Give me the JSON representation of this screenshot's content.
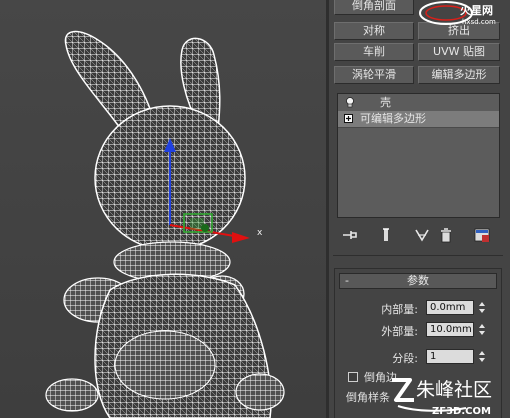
{
  "viewport": {
    "axis_label": "x"
  },
  "modifier_buttons": {
    "bevel_profile": "倒角剖面",
    "symmetry": "对称",
    "extrude": "挤出",
    "lathe": "车削",
    "uvw_map": "UVW 贴图",
    "turbosmooth": "涡轮平滑",
    "edit_poly": "编辑多边形"
  },
  "brand": {
    "logo_text": "火星网",
    "logo_sub": "hxsd.com"
  },
  "modifier_stack": {
    "items": [
      {
        "label": "壳",
        "icon": "lightbulb-icon"
      },
      {
        "label": "可编辑多边形",
        "icon": "expand-plus-icon"
      }
    ]
  },
  "stack_toolbar": {
    "icons": [
      "pin-stack-icon",
      "show-end-result-icon",
      "make-unique-icon",
      "remove-modifier-icon",
      "configure-modifier-sets-icon"
    ]
  },
  "parameters": {
    "title": "参数",
    "collapse_symbol": "-",
    "inner_amount_label": "内部量:",
    "inner_amount_value": "0.0mm",
    "outer_amount_label": "外部量:",
    "outer_amount_value": "10.0mm",
    "segments_label": "分段:",
    "segments_value": "1",
    "bevel_edges_label": "倒角边",
    "bevel_spline_label": "倒角样条"
  },
  "watermark": {
    "title": "朱峰社区",
    "sub": "ZF3D.COM"
  },
  "colors": {
    "viewport_bg": "#444444",
    "wire": "#ffffff",
    "axis_x": "#e01010",
    "axis_y": "#2040e0",
    "gizmo": "#30b030"
  }
}
